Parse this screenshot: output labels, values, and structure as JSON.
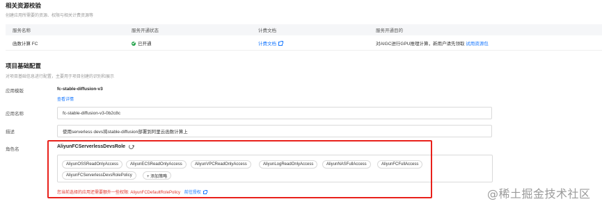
{
  "resource_check": {
    "title": "相关资源校验",
    "desc": "创建应用所需要的资源、权限与相关计费资源等",
    "headers": [
      "服务名称",
      "服务开通状态",
      "计费文档",
      "服务开通目的"
    ],
    "row": {
      "name": "函数计算 FC",
      "status": "已开通",
      "doc_link": "计费文档",
      "purpose": "对AIGC进行GPU推理计算，新用户请先领取",
      "purpose_link": "试用资源包"
    }
  },
  "project_config": {
    "title": "项目基础配置",
    "desc": "对项目基础信息进行配置，主要用于项目创建的识别和展示",
    "template_label": "应用模版",
    "template_value": "fc-stable-diffusion-v3",
    "template_link": "查看详情",
    "app_name_label": "应用名称",
    "app_name_value": "fc-stable-diffusion-v3-0b2c8c",
    "desc_label": "描述",
    "desc_value": "使用serverless devs将stable-diffusion部署到阿里云函数计算上",
    "role_label": "角色名",
    "role_value": "AliyunFCServerlessDevsRole",
    "policies": [
      "AliyunOSSReadOnlyAccess",
      "AliyunECSReadOnlyAccess",
      "AliyunVPCReadOnlyAccess",
      "AliyunLogReadOnlyAccess",
      "AliyunNASFullAccess",
      "AliyunFCFullAccess",
      "AliyunFCServerlessDevsRolePolicy"
    ],
    "add_policy": "+ 添加策略",
    "warning": "您当前选择的应用还需要额外一些权限: AliyunFCDefaultRolePolicy",
    "warning_link": "前往授权"
  },
  "watermark": "@稀土掘金技术社区",
  "colors": {
    "accent": "#1677ff",
    "success": "#23a34a",
    "warning": "#e0372e",
    "highlight_frame": "#e8201a"
  }
}
